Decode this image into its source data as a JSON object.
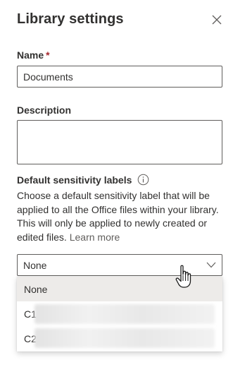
{
  "panel": {
    "title": "Library settings",
    "close_icon": "close-icon"
  },
  "name_field": {
    "label": "Name",
    "required_marker": "*",
    "value": "Documents"
  },
  "description_field": {
    "label": "Description",
    "value": ""
  },
  "sensitivity": {
    "label": "Default sensitivity labels",
    "info_icon": "info-icon",
    "help_text": "Choose a default sensitivity label that will be applied to all the Office files within your library. This will only be applied to newly created or edited files.",
    "learn_more": "Learn more",
    "dropdown": {
      "selected": "None",
      "chevron_icon": "chevron-down-icon",
      "options": [
        {
          "label": "None",
          "selected": true
        },
        {
          "label": "C1",
          "selected": false
        },
        {
          "label": "C2",
          "selected": false
        }
      ]
    }
  },
  "colors": {
    "required": "#a4262c",
    "text": "#323130",
    "link": "#605e5c",
    "selected_option_bg": "#edebe9"
  }
}
